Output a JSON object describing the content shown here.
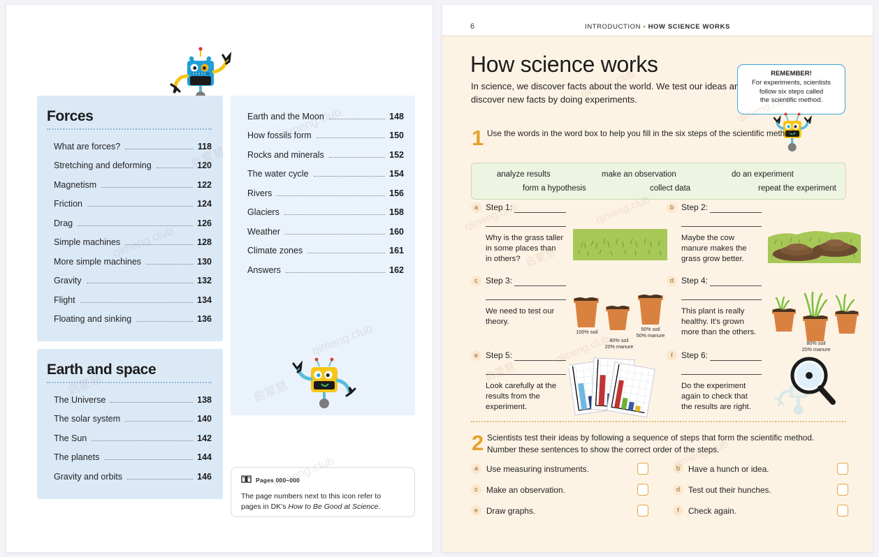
{
  "left_page": {
    "sections": [
      {
        "title": "Forces",
        "style": "boxed",
        "entries": [
          {
            "label": "What are forces?",
            "page": "118"
          },
          {
            "label": "Stretching and deforming",
            "page": "120"
          },
          {
            "label": "Magnetism",
            "page": "122"
          },
          {
            "label": "Friction",
            "page": "124"
          },
          {
            "label": "Drag",
            "page": "126"
          },
          {
            "label": "Simple machines",
            "page": "128"
          },
          {
            "label": "More simple machines",
            "page": "130"
          },
          {
            "label": "Gravity",
            "page": "132"
          },
          {
            "label": "Flight",
            "page": "134"
          },
          {
            "label": "Floating and sinking",
            "page": "136"
          }
        ]
      },
      {
        "title": "Earth and space",
        "style": "boxed",
        "entries": [
          {
            "label": "The Universe",
            "page": "138"
          },
          {
            "label": "The solar system",
            "page": "140"
          },
          {
            "label": "The Sun",
            "page": "142"
          },
          {
            "label": "The planets",
            "page": "144"
          },
          {
            "label": "Gravity and orbits",
            "page": "146"
          }
        ]
      }
    ],
    "column_two": {
      "entries": [
        {
          "label": "Earth and the Moon",
          "page": "148"
        },
        {
          "label": "How fossils form",
          "page": "150"
        },
        {
          "label": "Rocks and minerals",
          "page": "152"
        },
        {
          "label": "The water cycle",
          "page": "154"
        },
        {
          "label": "Rivers",
          "page": "156"
        },
        {
          "label": "Glaciers",
          "page": "158"
        },
        {
          "label": "Weather",
          "page": "160"
        },
        {
          "label": "Climate zones",
          "page": "161"
        },
        {
          "label": "Answers",
          "page": "162"
        }
      ]
    },
    "note": {
      "icon": "open-book-icon",
      "heading": "Pages 000–000",
      "line1": "The page numbers next to this icon refer to",
      "line2_prefix": "pages in DK's ",
      "line2_italic": "How to Be Good at Science",
      "line2_suffix": "."
    },
    "robots": [
      {
        "name": "blue-robot",
        "body": "#1f9fd8",
        "arms": "#f5c518"
      },
      {
        "name": "yellow-robot",
        "body": "#f5c518",
        "arms": "#5bbcd8"
      }
    ]
  },
  "right_page": {
    "folio": "6",
    "runhead_prefix": "INTRODUCTION",
    "runhead_separator": "•",
    "runhead_title": "HOW SCIENCE WORKS",
    "title": "How science works",
    "standfirst_line1": "In science, we discover facts about the world. We test",
    "standfirst_line2": "our ideas and discover new facts by doing experiments.",
    "remember": {
      "title": "REMEMBER!",
      "line1": "For experiments, scientists",
      "line2": "follow six steps called",
      "line3": "the scientific method."
    },
    "task1": {
      "number": "1",
      "line1": "Use the words in the word box to help you fill in the six steps",
      "line2": "of the scientific method.",
      "wordbox": [
        "analyze results",
        "make an observation",
        "do an experiment",
        "form a hypothesis",
        "collect data",
        "repeat the experiment"
      ]
    },
    "steps": [
      {
        "tag": "a",
        "label": "Step 1:",
        "caption": "Why is the grass taller in some places than in others?",
        "illustration": "grass-field"
      },
      {
        "tag": "b",
        "label": "Step 2:",
        "caption": "Maybe the cow manure makes the grass grow better.",
        "illustration": "manure-on-grass"
      },
      {
        "tag": "c",
        "label": "Step 3:",
        "caption": "We need to test our theory.",
        "illustration": "three-soil-pots",
        "pot_labels": [
          "100% soil",
          "80% soil 20% manure",
          "50% soil 50% manure"
        ]
      },
      {
        "tag": "d",
        "label": "Step 4:",
        "caption": "This plant is really healthy. It's grown more than the others.",
        "illustration": "three-plant-pots",
        "pot_labels": [
          "80% soil 20% manure"
        ]
      },
      {
        "tag": "e",
        "label": "Step 5:",
        "caption": "Look carefully at the results from the experiment.",
        "illustration": "bar-chart-sheets"
      },
      {
        "tag": "f",
        "label": "Step 6:",
        "caption": "Do the experiment again to check that the results are right.",
        "illustration": "magnifying-glass-robot"
      }
    ],
    "task2": {
      "number": "2",
      "line1": "Scientists test their ideas by following a sequence of steps that form the scientific method.",
      "line2": "Number these sentences to show the correct order of the steps.",
      "items": [
        {
          "tag": "a",
          "label": "Use measuring instruments.",
          "answer": ""
        },
        {
          "tag": "b",
          "label": "Have a hunch or idea.",
          "answer": ""
        },
        {
          "tag": "c",
          "label": "Make an observation.",
          "answer": ""
        },
        {
          "tag": "d",
          "label": "Test out their hunches.",
          "answer": ""
        },
        {
          "tag": "e",
          "label": "Draw graphs.",
          "answer": ""
        },
        {
          "tag": "f",
          "label": "Check again.",
          "answer": ""
        }
      ]
    }
  },
  "watermarks": [
    "qimeng.club",
    "启蒙慧"
  ],
  "colors": {
    "toc_box": "#dbe9f7",
    "page_cream": "#fdf3e5",
    "accent_orange": "#e5a12c",
    "wordbox_green": "#eef4e2",
    "remember_blue": "#3aa6d8",
    "grass_green": "#a7c857",
    "pot_terracotta": "#d9823f"
  }
}
